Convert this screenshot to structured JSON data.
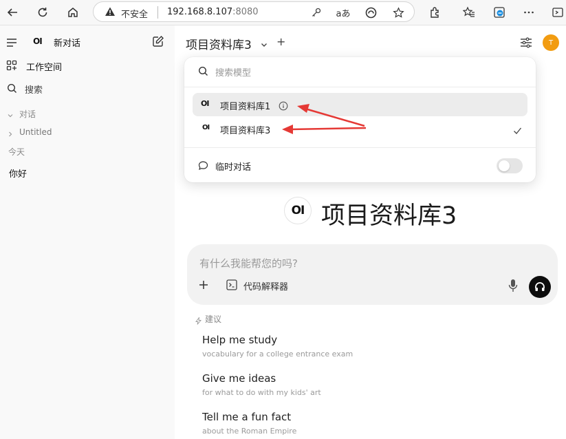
{
  "browser": {
    "insecure_label": "不安全",
    "url_host": "192.168.8.107",
    "url_port": ":8080",
    "icons": [
      "back-icon",
      "refresh-icon",
      "home-icon",
      "warning-icon",
      "key-icon",
      "read-aloud-icon",
      "edge-shield-icon",
      "star-icon",
      "extensions-icon",
      "favorites-icon",
      "collections-icon",
      "more-icon",
      "sidebar-icon"
    ]
  },
  "sidebar": {
    "new_chat": "新对话",
    "workspace": "工作空间",
    "search": "搜索",
    "folder_label": "对话",
    "untitled": "Untitled",
    "today_label": "今天",
    "today_items": [
      "你好"
    ]
  },
  "header": {
    "model_name": "项目资料库3",
    "add_symbol": "+",
    "avatar_initial": "T"
  },
  "dropdown": {
    "search_placeholder": "搜索模型",
    "models": [
      {
        "name": "项目资料库1",
        "active": true,
        "info": true,
        "selected": false
      },
      {
        "name": "项目资料库3",
        "active": false,
        "info": false,
        "selected": true
      }
    ],
    "temp_chat_label": "临时对话",
    "temp_chat_enabled": false
  },
  "hero": {
    "logo_text": "OI",
    "title": "项目资料库3"
  },
  "composer": {
    "placeholder": "有什么我能帮您的吗?",
    "code_interpreter": "代码解释器"
  },
  "suggestions": {
    "header": "建议",
    "items": [
      {
        "title": "Help me study",
        "subtitle": "vocabulary for a college entrance exam"
      },
      {
        "title": "Give me ideas",
        "subtitle": "for what to do with my kids' art"
      },
      {
        "title": "Tell me a fun fact",
        "subtitle": "about the Roman Empire"
      }
    ]
  },
  "colors": {
    "accent_avatar": "#f29c11",
    "annotation_arrow": "#e53935"
  }
}
